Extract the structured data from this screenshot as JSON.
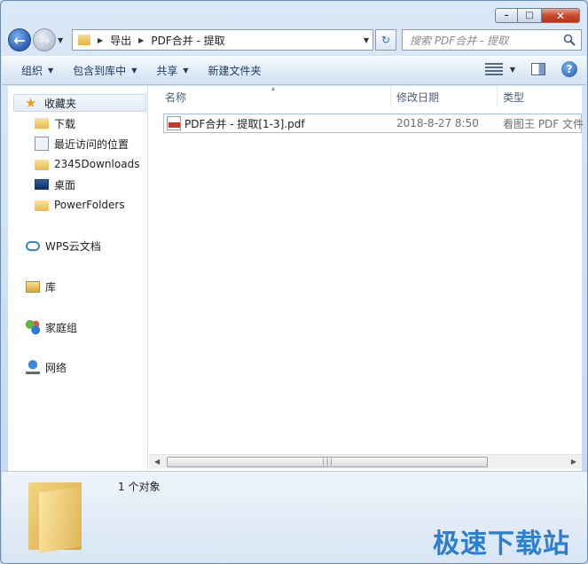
{
  "window": {
    "caption_min": "–",
    "caption_max": "□",
    "caption_close": "✕"
  },
  "navbar": {
    "breadcrumbs": [
      "导出",
      "PDF合并 - 提取"
    ],
    "search_placeholder": "搜索 PDF合并 - 提取"
  },
  "toolbar": {
    "organize": "组织",
    "include_in_library": "包含到库中",
    "share": "共享",
    "new_folder": "新建文件夹",
    "help": "?"
  },
  "sidebar": {
    "favorites": "收藏夹",
    "items": [
      {
        "label": "下载"
      },
      {
        "label": "最近访问的位置"
      },
      {
        "label": "2345Downloads"
      },
      {
        "label": "桌面"
      },
      {
        "label": "PowerFolders"
      }
    ],
    "wps_cloud": "WPS云文档",
    "libraries": "库",
    "homegroup": "家庭组",
    "network": "网络"
  },
  "columns": {
    "name": "名称",
    "modified": "修改日期",
    "type": "类型"
  },
  "files": [
    {
      "name": "PDF合并 - 提取[1-3].pdf",
      "modified": "2018-8-27 8:50",
      "type": "看图王 PDF 文件"
    }
  ],
  "details": {
    "status": "1 个对象"
  },
  "watermark": "极速下载站",
  "colors": {
    "accent": "#2b7ed1",
    "selection_border": "#a5bfdc",
    "toolbar_text": "#1e395b"
  }
}
